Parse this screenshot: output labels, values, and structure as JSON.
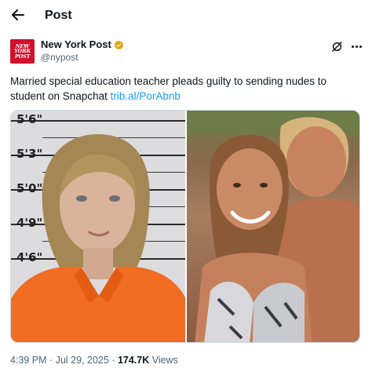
{
  "header": {
    "title": "Post"
  },
  "author": {
    "display_name": "New York Post",
    "handle": "@nypost",
    "avatar_text": [
      "NEW",
      "YORK",
      "POST"
    ],
    "brand_color": "#d0102c",
    "verified_color": "#e2a50c"
  },
  "tweet": {
    "text": "Married special education teacher pleads guilty to sending nudes to student on Snapchat ",
    "link": "trib.al/PorAbnb",
    "link_color": "#1d9bf0"
  },
  "media": {
    "height_chart_labels": [
      "5'6\"",
      "5'3\"",
      "5'0\"",
      "4'9\"",
      "4'6\""
    ]
  },
  "meta": {
    "time": "4:39 PM",
    "separator": "·",
    "date": "Jul 29, 2025",
    "views_count": "174.7K",
    "views_label": "Views"
  },
  "icons": {
    "back": "arrow-left-icon",
    "grok": "grok-icon",
    "more": "more-icon",
    "verified": "verified-badge-icon"
  }
}
